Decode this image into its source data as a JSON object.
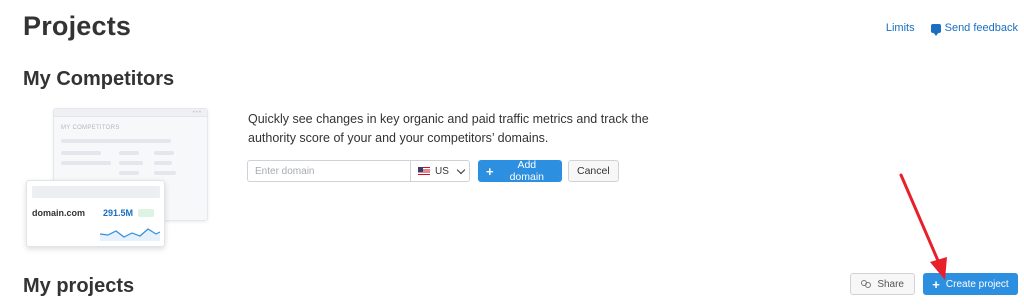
{
  "page": {
    "title": "Projects"
  },
  "header": {
    "limits_label": "Limits",
    "feedback_label": "Send feedback",
    "feedback_icon": "speech-bubble-icon"
  },
  "competitors": {
    "title": "My Competitors",
    "description": "Quickly see changes in key organic and paid traffic metrics and track the authority score of your and your competitors’ domains.",
    "illustration": {
      "panel_title": "MY COMPETITORS",
      "domain": "domain.com",
      "metric": "291.5M"
    },
    "form": {
      "domain_placeholder": "Enter domain",
      "country": "US",
      "add_label": "Add domain",
      "cancel_label": "Cancel"
    }
  },
  "projects": {
    "title": "My projects",
    "share_label": "Share",
    "create_label": "Create project"
  },
  "colors": {
    "primary": "#2d8fe0",
    "link": "#1a6fc0",
    "annotation": "#e8202a"
  }
}
